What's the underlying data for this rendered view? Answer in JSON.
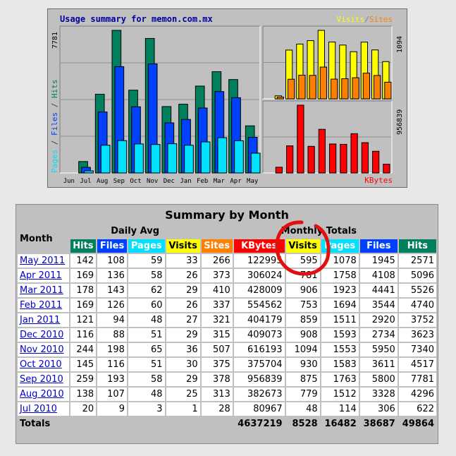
{
  "chart": {
    "title": "Usage summary for memon.com.mx",
    "legend_left": "Pages / Files / Hits",
    "legend_visits": "Visits",
    "legend_sep": "/",
    "legend_sites": "Sites",
    "kbytes_label": "KBytes",
    "max_hits": "7781",
    "max_visits": "1094",
    "max_kbytes": "956839",
    "colors": {
      "hits": "#00805c",
      "files": "#0040ff",
      "pages": "#00e0ff",
      "visits": "#ffff00",
      "sites": "#ff8000",
      "kbytes": "#ff0000",
      "title": "#0000a0"
    }
  },
  "chart_data": [
    {
      "type": "bar",
      "title": "Usage summary for memon.com.mx",
      "categories": [
        "Jun",
        "Jul",
        "Aug",
        "Sep",
        "Oct",
        "Nov",
        "Dec",
        "Jan",
        "Feb",
        "Mar",
        "Apr",
        "May"
      ],
      "series": [
        {
          "name": "Hits",
          "values": [
            0,
            622,
            4296,
            7781,
            4517,
            7340,
            3623,
            3752,
            4740,
            5526,
            5096,
            2571
          ]
        },
        {
          "name": "Files",
          "values": [
            0,
            306,
            3328,
            5800,
            3611,
            5950,
            2734,
            2920,
            3544,
            4441,
            4108,
            1945
          ]
        },
        {
          "name": "Pages",
          "values": [
            0,
            114,
            1512,
            1763,
            1583,
            1553,
            1593,
            1511,
            1694,
            1923,
            1758,
            1078
          ]
        }
      ],
      "ylim": [
        0,
        7781
      ]
    },
    {
      "type": "bar",
      "categories": [
        "Jun",
        "Jul",
        "Aug",
        "Sep",
        "Oct",
        "Nov",
        "Dec",
        "Jan",
        "Feb",
        "Mar",
        "Apr",
        "May"
      ],
      "series": [
        {
          "name": "Visits",
          "values": [
            0,
            48,
            779,
            875,
            930,
            1094,
            908,
            859,
            753,
            906,
            781,
            595
          ]
        },
        {
          "name": "Sites",
          "values": [
            0,
            28,
            313,
            378,
            375,
            507,
            315,
            321,
            337,
            410,
            373,
            266
          ]
        }
      ],
      "ylim": [
        0,
        1094
      ]
    },
    {
      "type": "bar",
      "categories": [
        "Jun",
        "Jul",
        "Aug",
        "Sep",
        "Oct",
        "Nov",
        "Dec",
        "Jan",
        "Feb",
        "Mar",
        "Apr",
        "May"
      ],
      "series": [
        {
          "name": "KBytes",
          "values": [
            0,
            80967,
            382673,
            956839,
            375704,
            616193,
            409073,
            404179,
            554562,
            428009,
            306024,
            122995
          ]
        }
      ],
      "ylim": [
        0,
        956839
      ]
    }
  ],
  "table": {
    "title": "Summary by Month",
    "month_header": "Month",
    "daily_header": "Daily Avg",
    "monthly_header": "Monthly Totals",
    "cols": {
      "hits": "Hits",
      "files": "Files",
      "pages": "Pages",
      "visits": "Visits",
      "sites": "Sites",
      "kbytes": "KBytes"
    },
    "rows": [
      {
        "month": "May 2011",
        "v": [
          "142",
          "108",
          "59",
          "33",
          "266",
          "122995",
          "595",
          "1078",
          "1945",
          "2571"
        ]
      },
      {
        "month": "Apr 2011",
        "v": [
          "169",
          "136",
          "58",
          "26",
          "373",
          "306024",
          "781",
          "1758",
          "4108",
          "5096"
        ]
      },
      {
        "month": "Mar 2011",
        "v": [
          "178",
          "143",
          "62",
          "29",
          "410",
          "428009",
          "906",
          "1923",
          "4441",
          "5526"
        ]
      },
      {
        "month": "Feb 2011",
        "v": [
          "169",
          "126",
          "60",
          "26",
          "337",
          "554562",
          "753",
          "1694",
          "3544",
          "4740"
        ]
      },
      {
        "month": "Jan 2011",
        "v": [
          "121",
          "94",
          "48",
          "27",
          "321",
          "404179",
          "859",
          "1511",
          "2920",
          "3752"
        ]
      },
      {
        "month": "Dec 2010",
        "v": [
          "116",
          "88",
          "51",
          "29",
          "315",
          "409073",
          "908",
          "1593",
          "2734",
          "3623"
        ]
      },
      {
        "month": "Nov 2010",
        "v": [
          "244",
          "198",
          "65",
          "36",
          "507",
          "616193",
          "1094",
          "1553",
          "5950",
          "7340"
        ]
      },
      {
        "month": "Oct 2010",
        "v": [
          "145",
          "116",
          "51",
          "30",
          "375",
          "375704",
          "930",
          "1583",
          "3611",
          "4517"
        ]
      },
      {
        "month": "Sep 2010",
        "v": [
          "259",
          "193",
          "58",
          "29",
          "378",
          "956839",
          "875",
          "1763",
          "5800",
          "7781"
        ]
      },
      {
        "month": "Aug 2010",
        "v": [
          "138",
          "107",
          "48",
          "25",
          "313",
          "382673",
          "779",
          "1512",
          "3328",
          "4296"
        ]
      },
      {
        "month": "Jul 2010",
        "v": [
          "20",
          "9",
          "3",
          "1",
          "28",
          "80967",
          "48",
          "114",
          "306",
          "622"
        ]
      }
    ],
    "totals": {
      "label": "Totals",
      "kbytes": "4637219",
      "visits": "8528",
      "pages": "16482",
      "files": "38687",
      "hits": "49864"
    }
  }
}
